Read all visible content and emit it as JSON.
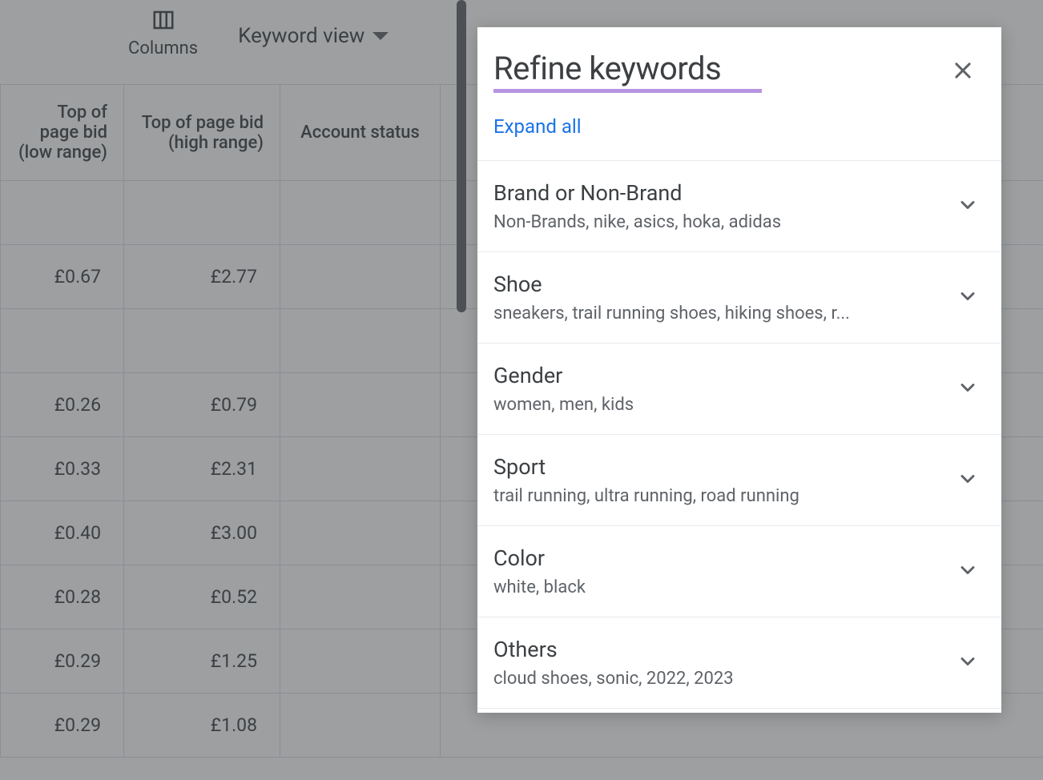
{
  "toolbar": {
    "columns_label": "Columns",
    "keyword_view_label": "Keyword view"
  },
  "table": {
    "headers": {
      "low_bid": "Top of page bid (low range)",
      "high_bid": "Top of page bid (high range)",
      "account_status": "Account status"
    },
    "rows": [
      {
        "low": "",
        "high": "",
        "spacer": true
      },
      {
        "low": "£0.67",
        "high": "£2.77"
      },
      {
        "low": "",
        "high": "",
        "spacer": true
      },
      {
        "low": "£0.26",
        "high": "£0.79"
      },
      {
        "low": "£0.33",
        "high": "£2.31"
      },
      {
        "low": "£0.40",
        "high": "£3.00"
      },
      {
        "low": "£0.28",
        "high": "£0.52"
      },
      {
        "low": "£0.29",
        "high": "£1.25"
      },
      {
        "low": "£0.29",
        "high": "£1.08"
      }
    ]
  },
  "panel": {
    "title": "Refine keywords",
    "expand_all": "Expand all",
    "groups": [
      {
        "title": "Brand or Non-Brand",
        "values": "Non-Brands, nike, asics, hoka, adidas"
      },
      {
        "title": "Shoe",
        "values": "sneakers, trail running shoes, hiking shoes, r..."
      },
      {
        "title": "Gender",
        "values": "women, men, kids"
      },
      {
        "title": "Sport",
        "values": "trail running, ultra running, road running"
      },
      {
        "title": "Color",
        "values": "white, black"
      },
      {
        "title": "Others",
        "values": "cloud shoes, sonic, 2022, 2023"
      }
    ]
  }
}
